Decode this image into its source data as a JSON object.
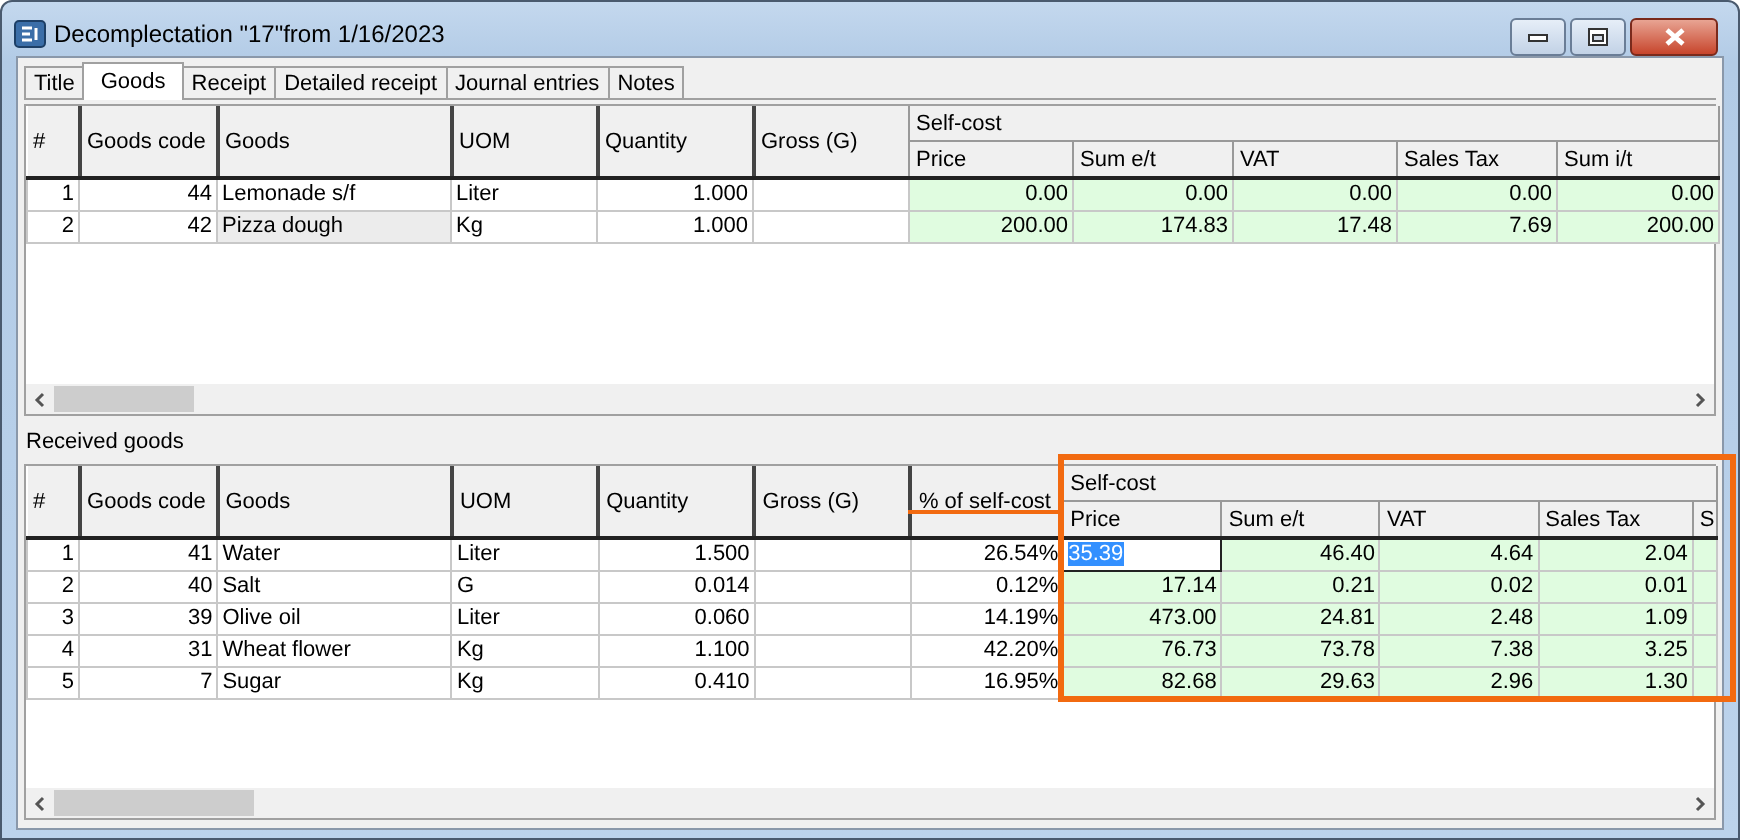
{
  "window": {
    "title": "Decomplectation \"17\"from 1/16/2023"
  },
  "tabs": [
    {
      "label": "Title",
      "selected": false
    },
    {
      "label": "Goods",
      "selected": true
    },
    {
      "label": "Receipt",
      "selected": false
    },
    {
      "label": "Detailed receipt",
      "selected": false
    },
    {
      "label": "Journal entries",
      "selected": false
    },
    {
      "label": "Notes",
      "selected": false
    }
  ],
  "upper_table": {
    "columns": [
      "#",
      "Goods code",
      "Goods",
      "UOM",
      "Quantity",
      "Gross (G)"
    ],
    "group_header": "Self-cost",
    "group_columns": [
      "Price",
      "Sum e/t",
      "VAT",
      "Sales Tax",
      "Sum i/t"
    ],
    "rows": [
      {
        "number": "1",
        "code": "44",
        "goods": "Lemonade s/f",
        "uom": "Liter",
        "quantity": "1.000",
        "costs": [
          "0.00",
          "0.00",
          "0.00",
          "0.00",
          "0.00"
        ],
        "selected": false
      },
      {
        "number": "2",
        "code": "42",
        "goods": "Pizza dough",
        "uom": "Kg",
        "quantity": "1.000",
        "costs": [
          "200.00",
          "174.83",
          "17.48",
          "7.69",
          "200.00"
        ],
        "selected": true
      }
    ]
  },
  "received_goods": {
    "label": "Received goods",
    "columns": [
      "#",
      "Goods code",
      "Goods",
      "UOM",
      "Quantity",
      "Gross (G)",
      "% of self-cost"
    ],
    "group_header": "Self-cost",
    "group_columns": [
      "Price",
      "Sum e/t",
      "VAT",
      "Sales Tax",
      "S"
    ],
    "rows": [
      {
        "number": "1",
        "code": "41",
        "goods": "Water",
        "uom": "Liter",
        "quantity": "1.500",
        "share": "26.54%",
        "costs": [
          "35.39",
          "46.40",
          "4.64",
          "2.04"
        ],
        "selected": true
      },
      {
        "number": "2",
        "code": "40",
        "goods": "Salt",
        "uom": "G",
        "quantity": "0.014",
        "share": "0.12%",
        "costs": [
          "17.14",
          "0.21",
          "0.02",
          "0.01"
        ],
        "selected": false
      },
      {
        "number": "3",
        "code": "39",
        "goods": "Olive oil",
        "uom": "Liter",
        "quantity": "0.060",
        "share": "14.19%",
        "costs": [
          "473.00",
          "24.81",
          "2.48",
          "1.09"
        ],
        "selected": false
      },
      {
        "number": "4",
        "code": "31",
        "goods": "Wheat flower",
        "uom": "Kg",
        "quantity": "1.100",
        "share": "42.20%",
        "costs": [
          "76.73",
          "73.78",
          "7.38",
          "3.25"
        ],
        "selected": false
      },
      {
        "number": "5",
        "code": "7",
        "goods": "Sugar",
        "uom": "Kg",
        "quantity": "0.410",
        "share": "16.95%",
        "costs": [
          "82.68",
          "29.63",
          "2.96",
          "1.30"
        ],
        "selected": false
      }
    ]
  }
}
